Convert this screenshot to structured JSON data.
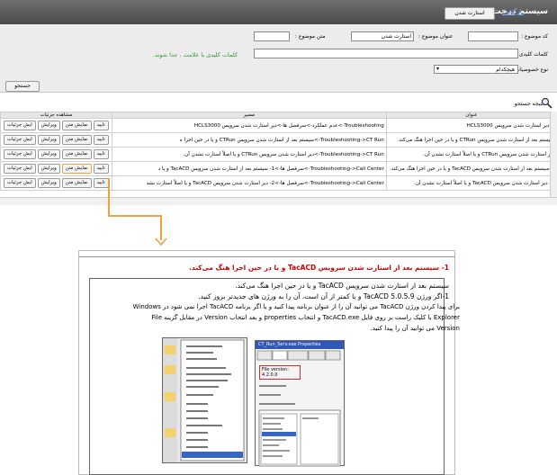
{
  "header": {
    "title": "سیستم درخت دانش",
    "button_label": "استارت شدن",
    "back_link": "بازگشت"
  },
  "form": {
    "code_label": "کد موضوع :",
    "title_label": "عنوان موضوع :",
    "title_value": "استارت شدن",
    "type_label": "متن موضوع :",
    "keywords_label": "کلمات کلیدی :",
    "keywords_note": "کلمات کلیدی با علامت ، جدا شوند.",
    "feature_label": "نوع خصوصیات :",
    "feature_value": "هیچکدام",
    "search_button": "جستجو"
  },
  "results": {
    "title": "نتیجه جستجو",
    "columns": [
      "عنوان",
      "مسیر",
      "مشاهده جزئیات"
    ],
    "rows": [
      {
        "title": "1-دیر استارت شدن سرویس HCLS3000",
        "path": "Troubleshooting->عدم عملکرد->سرفصل ها->دیر استارت شدن سرویس HCLS3000"
      },
      {
        "title": "سیستم بعد از استارت شدن سرویس CTRun و یا در حین اجرا هنگ می‌کند.",
        "path": "Troubleshooting->CT Run->سیستم بعد از استارت شدن سرویس CTRun و یا در حین اجرا ه"
      },
      {
        "title": "دیر استارت شدن سرویس CTRun و یا اصلاً استارت نشدن آن.",
        "path": "Troubleshooting->CT Run->دیر استارت شدن سرویس CTRun و یا اصلاً استارت نشدن آن."
      },
      {
        "title": "1-سیستم بعد از استارت شدن سرویس TacACD و یا در حین اجرا هنگ می‌کند.",
        "path": "Troubleshooting->Call Center->سرفصل ها->1- سیستم بعد از استارت شدن سرویس TacACD و یا د"
      },
      {
        "title": "2- دیر استارت شدن سرویس TacACD و یا اصلاً استارت نشدن آن.",
        "path": "Troubleshooting->Call Center->سرفصل ها->2- دیر استارت شدن سرویس TacACD و یا اصلاً استارت نشد"
      }
    ],
    "btn_confirm": "تایید",
    "btn_show_text": "نمایش متن",
    "btn_edit": "ویرایش",
    "btn_details": "ایش جزئیات"
  },
  "document": {
    "title": "1-  سیستم بعد از استارت شدن سرویس TacACD و یا در حین اجرا هنگ می‌کند.",
    "lines": [
      "سیستم بعد از استارت شدن سرویس  TacACD و یا در حین اجرا هنگ می‌کند.",
      "1-اگر ورژن  TacACD 5.0.5.9 و یا کمتر از آن است، آن را به ورژن های جدیدتر بروز کنید.",
      "برای پیدا کردن ورژن  TacACD می توانید آن را از عنوان برنامه پیدا کنید و یا اگر برنامه  TacACD اجرا نمی شود در  Windows",
      "Explorer با کلیک راست بر روی فایل  TacACD.exe و انتخاب  properties و بعد انتخاب  Version در مقابل گزینه  File",
      "Version می توانید آن را پیدا کنید."
    ],
    "props_title": "CT_Run_Serv.exe Properties",
    "file_version": "File version:  4.2.0.0"
  }
}
